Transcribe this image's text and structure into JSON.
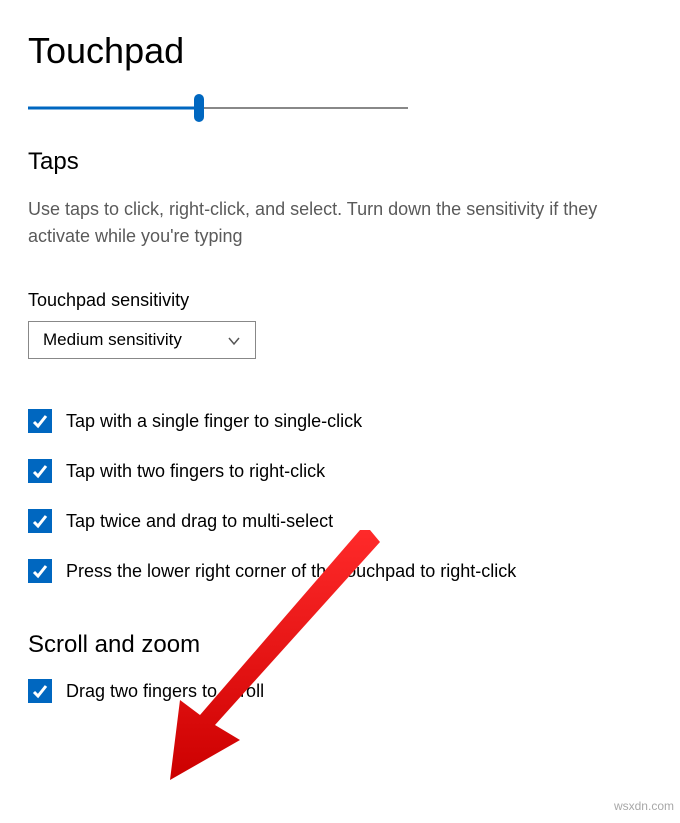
{
  "page": {
    "title": "Touchpad"
  },
  "slider": {
    "value_percent": 45
  },
  "taps": {
    "heading": "Taps",
    "description": "Use taps to click, right-click, and select. Turn down the sensitivity if they activate while you're typing",
    "sensitivity_label": "Touchpad sensitivity",
    "sensitivity_value": "Medium sensitivity",
    "checkboxes": [
      {
        "label": "Tap with a single finger to single-click",
        "checked": true
      },
      {
        "label": "Tap with two fingers to right-click",
        "checked": true
      },
      {
        "label": "Tap twice and drag to multi-select",
        "checked": true
      },
      {
        "label": "Press the lower right corner of the touchpad to right-click",
        "checked": true
      }
    ]
  },
  "scroll": {
    "heading": "Scroll and zoom",
    "checkboxes": [
      {
        "label": "Drag two fingers to scroll",
        "checked": true
      }
    ]
  },
  "watermark": "wsxdn.com",
  "colors": {
    "accent": "#0067c0"
  }
}
